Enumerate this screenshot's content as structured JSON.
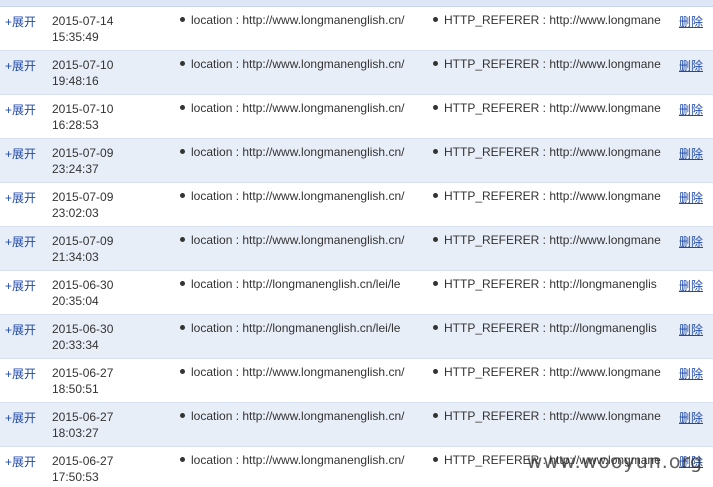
{
  "watermark": "www.wooyun.org",
  "labels": {
    "expand": "+展开",
    "delete": "删除"
  },
  "rows": [
    {
      "date": "2015-07-14",
      "time": "15:35:49",
      "location": "location : http://www.longmanenglish.cn/",
      "referer": "HTTP_REFERER : http://www.longmane"
    },
    {
      "date": "2015-07-10",
      "time": "19:48:16",
      "location": "location : http://www.longmanenglish.cn/",
      "referer": "HTTP_REFERER : http://www.longmane"
    },
    {
      "date": "2015-07-10",
      "time": "16:28:53",
      "location": "location : http://www.longmanenglish.cn/",
      "referer": "HTTP_REFERER : http://www.longmane"
    },
    {
      "date": "2015-07-09",
      "time": "23:24:37",
      "location": "location : http://www.longmanenglish.cn/",
      "referer": "HTTP_REFERER : http://www.longmane"
    },
    {
      "date": "2015-07-09",
      "time": "23:02:03",
      "location": "location : http://www.longmanenglish.cn/",
      "referer": "HTTP_REFERER : http://www.longmane"
    },
    {
      "date": "2015-07-09",
      "time": "21:34:03",
      "location": "location : http://www.longmanenglish.cn/",
      "referer": "HTTP_REFERER : http://www.longmane"
    },
    {
      "date": "2015-06-30",
      "time": "20:35:04",
      "location": "location : http://longmanenglish.cn/lei/le",
      "referer": "HTTP_REFERER : http://longmanenglis"
    },
    {
      "date": "2015-06-30",
      "time": "20:33:34",
      "location": "location : http://longmanenglish.cn/lei/le",
      "referer": "HTTP_REFERER : http://longmanenglis"
    },
    {
      "date": "2015-06-27",
      "time": "18:50:51",
      "location": "location : http://www.longmanenglish.cn/",
      "referer": "HTTP_REFERER : http://www.longmane"
    },
    {
      "date": "2015-06-27",
      "time": "18:03:27",
      "location": "location : http://www.longmanenglish.cn/",
      "referer": "HTTP_REFERER : http://www.longmane"
    },
    {
      "date": "2015-06-27",
      "time": "17:50:53",
      "location": "location : http://www.longmanenglish.cn/",
      "referer": "HTTP_REFERER : http://www.longmane"
    }
  ]
}
